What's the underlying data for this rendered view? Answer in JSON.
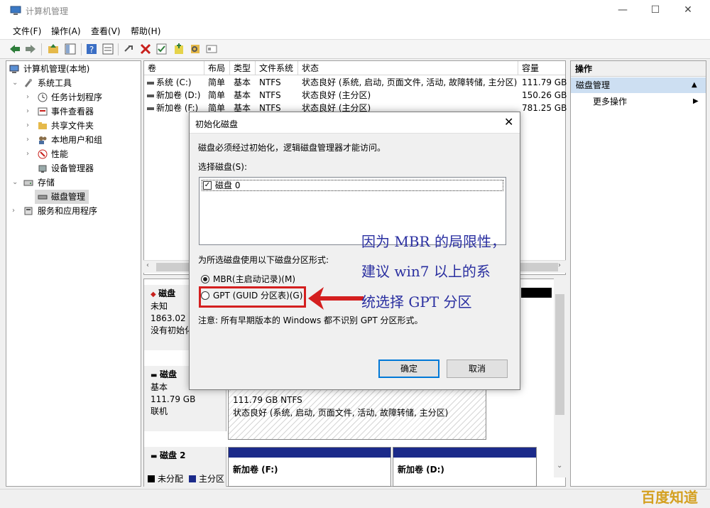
{
  "window": {
    "title": "计算机管理",
    "min_glyph": "—",
    "max_glyph": "☐",
    "close_glyph": "✕"
  },
  "menu": [
    "文件(F)",
    "操作(A)",
    "查看(V)",
    "帮助(H)"
  ],
  "tree": {
    "root": "计算机管理(本地)",
    "system_tools": "系统工具",
    "task_scheduler": "任务计划程序",
    "event_viewer": "事件查看器",
    "shared_folders": "共享文件夹",
    "local_users": "本地用户和组",
    "performance": "性能",
    "device_manager": "设备管理器",
    "storage": "存储",
    "disk_management": "磁盘管理",
    "services_apps": "服务和应用程序"
  },
  "volume_table": {
    "columns": [
      "卷",
      "布局",
      "类型",
      "文件系统",
      "状态",
      "容量"
    ],
    "rows": [
      {
        "volume": "系统 (C:)",
        "layout": "简单",
        "type": "基本",
        "fs": "NTFS",
        "status": "状态良好 (系统, 启动, 页面文件, 活动, 故障转储, 主分区)",
        "capacity": "111.79 GB"
      },
      {
        "volume": "新加卷 (D:)",
        "layout": "简单",
        "type": "基本",
        "fs": "NTFS",
        "status": "状态良好 (主分区)",
        "capacity": "150.26 GB"
      },
      {
        "volume": "新加卷 (F:)",
        "layout": "简单",
        "type": "基本",
        "fs": "NTFS",
        "status": "状态良好 (主分区)",
        "capacity": "781.25 GB"
      }
    ]
  },
  "disks": {
    "disk0": {
      "name": "磁盘",
      "type": "未知",
      "size": "1863.02 G",
      "state": "没有初始化"
    },
    "disk1": {
      "name": "磁盘",
      "type": "基本",
      "size": "111.79 GB",
      "state": "联机",
      "part_size": "111.79 GB NTFS",
      "part_status": "状态良好 (系统, 启动, 页面文件, 活动, 故障转储, 主分区)"
    },
    "disk2": {
      "name": "磁盘 2",
      "vol_f": "新加卷 (F:)",
      "vol_d": "新加卷 (D:)"
    }
  },
  "legend": {
    "unallocated": "未分配",
    "primary": "主分区"
  },
  "actions": {
    "header": "操作",
    "selected": "磁盘管理",
    "more": "更多操作"
  },
  "dialog": {
    "title": "初始化磁盘",
    "description": "磁盘必须经过初始化，逻辑磁盘管理器才能访问。",
    "select_label": "选择磁盘(S):",
    "disk_item": "磁盘 0",
    "partition_label": "为所选磁盘使用以下磁盘分区形式:",
    "mbr_option": "MBR(主启动记录)(M)",
    "gpt_option": "GPT (GUID 分区表)(G)",
    "note": "注意: 所有早期版本的 Windows 都不识别 GPT 分区形式。",
    "ok": "确定",
    "cancel": "取消"
  },
  "annotation": {
    "line1": "因为 MBR 的局限性，",
    "line2": "建议 win7 以上的系",
    "line3": "统选择 GPT 分区"
  },
  "watermark": "百度知道",
  "colors": {
    "primary_partition": "#1b2a8a",
    "unallocated": "#000000",
    "highlight": "#d41f1f",
    "annotation": "#2a2fa0",
    "selection": "#cddff2"
  }
}
